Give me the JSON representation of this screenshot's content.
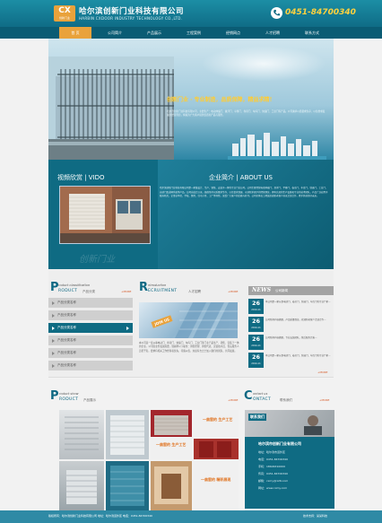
{
  "header": {
    "logo_text": "CX",
    "logo_sub": "创新门业",
    "company_cn": "哈尔滨创新门业科技有限公司",
    "company_en": "HARBIN CXDOOR INDUSTRY TECHNOLOGY CO.,LTD.",
    "phone": "0451-84700340"
  },
  "nav": {
    "items": [
      "首 页",
      "公司简介",
      "产品展示",
      "工程案例",
      "经销网点",
      "人才招聘",
      "联系方式"
    ],
    "active_index": 0
  },
  "banner": {
    "slogan": "创新门业 · 专业制造，品质保障，精益求精！",
    "desc": "哈尔滨创新门业科技有限公司，主要生产：电动伸缩门、悬浮门、平移门、卷帘门、车库门、快速门、工业门等产品，公司秉承以质量求生存、以信誉求发展的经营理念，竭诚为广大客户提供优质的产品与服务。"
  },
  "video": {
    "title": "视频欣赏 | VIDO"
  },
  "about": {
    "title": "企业简介 | ABOUT US",
    "text": "哈尔滨创新门业科技有限公司是一家集设计、生产、销售、安装于一体的专业门业公司，公司主要经营电动伸缩门、悬浮门、平移门、卷帘门、车库门、快速门、工业门、自动门及道闸系统等产品。公司自成立以来，始终坚持以质量求生存、以信誉求发展、以创新求进步的经营理念，拥有先进的生产设备和专业的技术团队，产品广泛应用于政府机关、企事业单位、学校、医院、住宅小区、工厂等场所，深受广大客户的信赖与好评。公司全体员工竭诚欢迎新老客户前来洽谈合作，携手共创美好未来。",
    "watermark": "创新门业"
  },
  "product_category": {
    "letter": "P",
    "small": "roduct classification",
    "en": "RODUCT",
    "cn": "产品分类",
    "more": "+MORE",
    "items": [
      "产品分类名称",
      "产品分类名称",
      "产品分类名称",
      "产品分类名称",
      "产品分类名称",
      "产品分类名称"
    ],
    "active_index": 2
  },
  "recruit": {
    "letter": "R",
    "small": "ntroduction",
    "en": "ECRUITMENT",
    "cn": "人才招聘",
    "more": "+MORE",
    "img_text": "JOIN US",
    "text": "本公司是一家从事电动门、卷帘门、快速门、车库门、工业门等门业产品生产、销售、安装于一体的企业。公司因业务发展需要，现诚聘以下职位：销售经理、销售代表、安装技术员、售后服务人员若干名。要求有相关工作经验者优先，待遇从优，欢迎有志之士加入我们的团队，共同发展。"
  },
  "news": {
    "title_en": "NEWS",
    "title_cn": "公司新闻",
    "more": "+MORE",
    "items": [
      {
        "day": "26",
        "month": "2014-11",
        "text": "本公司是一家从事电动门、卷帘门、快速门、车库门的专业厂家..."
      },
      {
        "day": "26",
        "month": "2014-11",
        "text": "公司新闻内容摘要，产品质量保证，欢迎新老客户洽谈合作..."
      },
      {
        "day": "26",
        "month": "2014-11",
        "text": "公司新闻内容摘要，专业安装团队，售后服务完善..."
      },
      {
        "day": "26",
        "month": "2014-11",
        "text": "本公司是一家从事电动门、卷帘门、快速门、车库门的专业厂家..."
      }
    ]
  },
  "products": {
    "letter": "P",
    "small": "roduct show",
    "en": "RODUCT",
    "cn": "产品展示",
    "more": "+MORE",
    "tag_1": "一扇窗的 生产工艺",
    "tag_2": "一扇窗的 生产工艺",
    "tag_3": "一扇窗的 精彩展现"
  },
  "contact": {
    "letter": "C",
    "small": "ontact us",
    "en": "ONTACT",
    "cn": "联系我们",
    "more": "+MORE",
    "img_text": "联系我们",
    "company": "哈尔滨市创新门业有限公司",
    "lines": [
      "地址：哈尔滨市道外区",
      "电话：0451-84700340",
      "手机：18646310000",
      "传真：0451-84700340",
      "邮箱：cxmy@126.com",
      "网址：www.cxmy.com"
    ]
  },
  "footer": {
    "left": "版权所有：哈尔滨创新门业科技有限公司  地址：哈尔滨道外区  电话：0451-84700340",
    "right": "技术支持：某某科技"
  },
  "colors": {
    "primary": "#0f6b83",
    "accent": "#e9a23b",
    "phone": "#ffd23e",
    "more": "#d65b2a"
  }
}
